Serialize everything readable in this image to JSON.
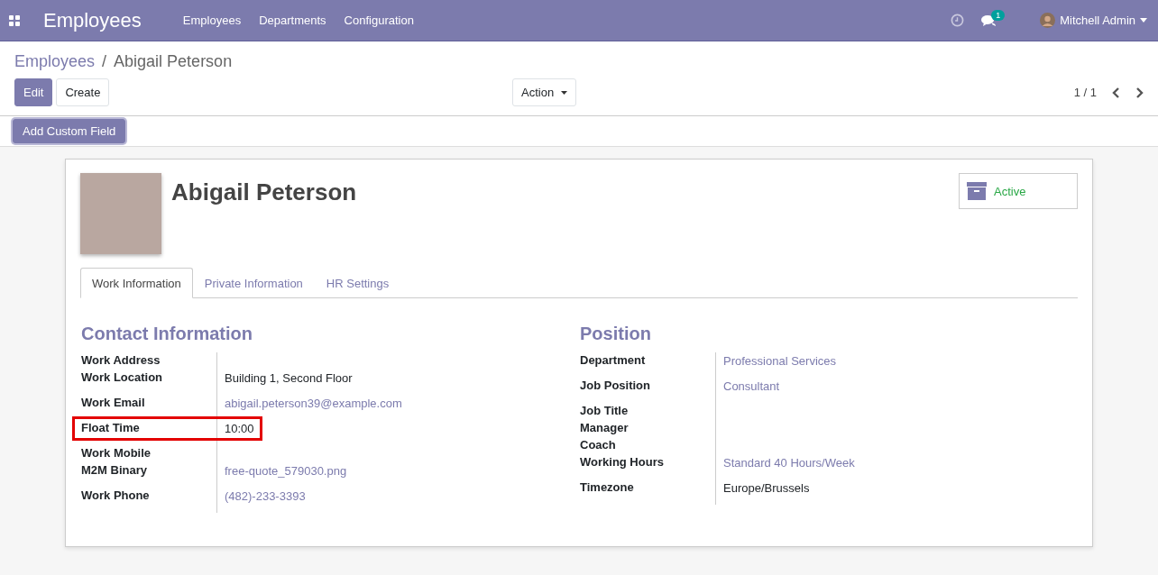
{
  "navbar": {
    "app_name": "Employees",
    "menu": [
      "Employees",
      "Departments",
      "Configuration"
    ],
    "message_count": "1",
    "user": "Mitchell Admin"
  },
  "breadcrumb": {
    "parent": "Employees",
    "separator": "/",
    "current": "Abigail Peterson"
  },
  "buttons": {
    "edit": "Edit",
    "create": "Create",
    "action": "Action",
    "add_custom_field": "Add Custom Field"
  },
  "pager": "1 / 1",
  "employee": {
    "name": "Abigail Peterson",
    "status": "Active"
  },
  "tabs": [
    {
      "label": "Work Information",
      "selected": true
    },
    {
      "label": "Private Information",
      "selected": false
    },
    {
      "label": "HR Settings",
      "selected": false
    }
  ],
  "left_section": {
    "title": "Contact Information",
    "fields": [
      {
        "label": "Work Address",
        "kind": "empty",
        "highlighted": false
      },
      {
        "label": "Work Location",
        "kind": "text",
        "value": "Building 1, Second Floor",
        "highlighted": false
      },
      {
        "label": "Work Email",
        "kind": "link",
        "value": "abigail.peterson39@example.com",
        "highlighted": false
      },
      {
        "label": "Float Time",
        "kind": "text",
        "value": "10:00",
        "highlighted": true
      },
      {
        "label": "Work Mobile",
        "kind": "empty",
        "highlighted": false
      },
      {
        "label": "M2M Binary",
        "kind": "link",
        "value": "free-quote_579030.png",
        "highlighted": false
      },
      {
        "label": "Work Phone",
        "kind": "link",
        "value": "(482)-233-3393",
        "highlighted": false
      }
    ]
  },
  "right_section": {
    "title": "Position",
    "fields": [
      {
        "label": "Department",
        "kind": "link",
        "value": "Professional Services",
        "highlighted": false
      },
      {
        "label": "Job Position",
        "kind": "link",
        "value": "Consultant",
        "highlighted": false
      },
      {
        "label": "Job Title",
        "kind": "empty",
        "highlighted": false
      },
      {
        "label": "Manager",
        "kind": "empty",
        "highlighted": false
      },
      {
        "label": "Coach",
        "kind": "empty",
        "highlighted": false
      },
      {
        "label": "Working Hours",
        "kind": "link",
        "value": "Standard 40 Hours/Week",
        "highlighted": false
      },
      {
        "label": "Timezone",
        "kind": "text",
        "value": "Europe/Brussels",
        "highlighted": false
      }
    ]
  }
}
